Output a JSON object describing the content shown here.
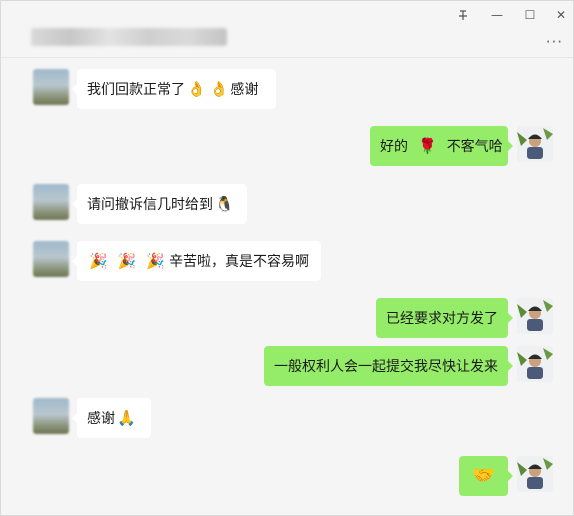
{
  "window": {
    "pin_icon": "pin-icon",
    "minimize_label": "—",
    "maximize_label": "☐",
    "close_label": "✕",
    "more_label": "···"
  },
  "messages": [
    {
      "side": "left",
      "parts": [
        "我们回款正常了",
        "👌",
        "👌",
        "感谢"
      ]
    },
    {
      "side": "right",
      "parts": [
        "好的",
        "🌹",
        "不客气哈"
      ]
    },
    {
      "side": "left",
      "parts": [
        "请问撤诉信几时给到",
        "🐧"
      ]
    },
    {
      "side": "left",
      "parts": [
        "🎉",
        "🎉",
        "🎉",
        "辛苦啦，真是不容易啊"
      ]
    },
    {
      "side": "right",
      "parts": [
        "已经要求对方发了"
      ]
    },
    {
      "side": "right",
      "parts": [
        "一般权利人会一起提交我尽快让发来"
      ]
    },
    {
      "side": "left",
      "parts": [
        "感谢",
        "🙏"
      ]
    },
    {
      "side": "right",
      "parts": [
        "🤝"
      ]
    }
  ],
  "colors": {
    "background": "#f5f5f5",
    "bubble_right": "#95ec69",
    "bubble_left": "#ffffff"
  }
}
